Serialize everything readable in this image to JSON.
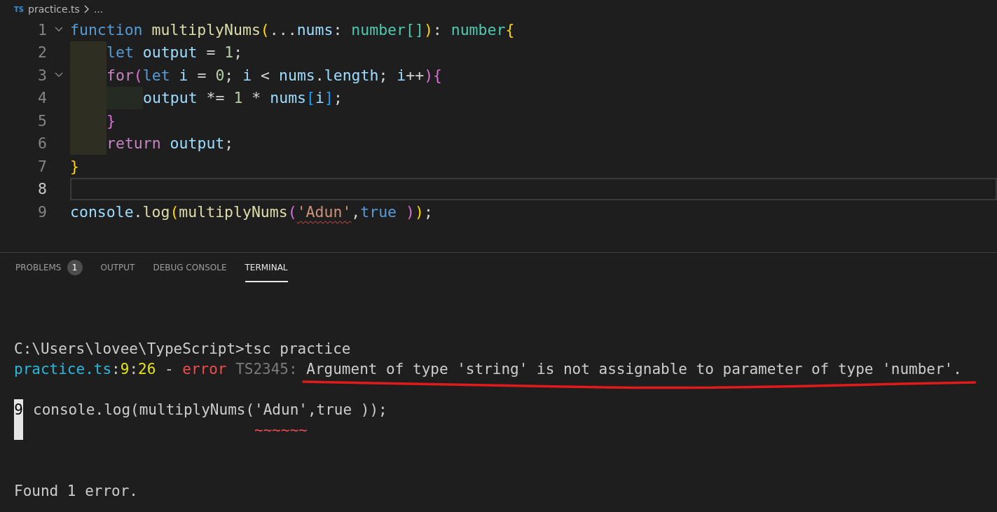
{
  "breadcrumbs": {
    "file_badge": "TS",
    "file": "practice.ts",
    "trail": "..."
  },
  "editor": {
    "lines": [
      {
        "number": "1",
        "current": false,
        "expanded": true,
        "tokens": [
          {
            "kind": "keyword",
            "text": "function "
          },
          {
            "kind": "func",
            "text": "multiplyNums"
          },
          {
            "kind": "bracket1",
            "text": "("
          },
          {
            "kind": "plain",
            "text": "..."
          },
          {
            "kind": "var",
            "text": "nums"
          },
          {
            "kind": "plain",
            "text": ": "
          },
          {
            "kind": "type",
            "text": "number[]"
          },
          {
            "kind": "bracket1",
            "text": ")"
          },
          {
            "kind": "plain",
            "text": ": "
          },
          {
            "kind": "type",
            "text": "number"
          },
          {
            "kind": "bracket1",
            "text": "{"
          }
        ],
        "children": [
          {
            "number": "2",
            "current": false,
            "tokens": [
              {
                "kind": "keyword",
                "text": "let "
              },
              {
                "kind": "var",
                "text": "output"
              },
              {
                "kind": "plain",
                "text": " = "
              },
              {
                "kind": "num",
                "text": "1"
              },
              {
                "kind": "plain",
                "text": ";"
              }
            ]
          },
          {
            "number": "3",
            "current": false,
            "expanded": true,
            "tokens": [
              {
                "kind": "control",
                "text": "for"
              },
              {
                "kind": "bracket2",
                "text": "("
              },
              {
                "kind": "keyword",
                "text": "let "
              },
              {
                "kind": "var",
                "text": "i"
              },
              {
                "kind": "plain",
                "text": " = "
              },
              {
                "kind": "num",
                "text": "0"
              },
              {
                "kind": "plain",
                "text": "; "
              },
              {
                "kind": "var",
                "text": "i"
              },
              {
                "kind": "plain",
                "text": " < "
              },
              {
                "kind": "var",
                "text": "nums"
              },
              {
                "kind": "plain",
                "text": "."
              },
              {
                "kind": "var",
                "text": "length"
              },
              {
                "kind": "plain",
                "text": "; "
              },
              {
                "kind": "var",
                "text": "i"
              },
              {
                "kind": "plain",
                "text": "++"
              },
              {
                "kind": "bracket2",
                "text": ")"
              },
              {
                "kind": "bracket2",
                "text": "{"
              }
            ],
            "children": [
              {
                "number": "4",
                "current": false,
                "tokens": [
                  {
                    "kind": "var",
                    "text": "output"
                  },
                  {
                    "kind": "plain",
                    "text": " *= "
                  },
                  {
                    "kind": "num",
                    "text": "1"
                  },
                  {
                    "kind": "plain",
                    "text": " * "
                  },
                  {
                    "kind": "var",
                    "text": "nums"
                  },
                  {
                    "kind": "bracket3",
                    "text": "["
                  },
                  {
                    "kind": "var",
                    "text": "i"
                  },
                  {
                    "kind": "bracket3",
                    "text": "]"
                  },
                  {
                    "kind": "plain",
                    "text": ";"
                  }
                ]
              }
            ]
          },
          {
            "number": "5",
            "current": false,
            "tokens": [
              {
                "kind": "bracket2",
                "text": "}"
              }
            ]
          },
          {
            "number": "6",
            "current": false,
            "tokens": [
              {
                "kind": "control",
                "text": "return "
              },
              {
                "kind": "var",
                "text": "output"
              },
              {
                "kind": "plain",
                "text": ";"
              }
            ]
          }
        ]
      },
      {
        "number": "7",
        "current": false,
        "tokens": [
          {
            "kind": "bracket1",
            "text": "}"
          }
        ]
      },
      {
        "number": "8",
        "current": true
      },
      {
        "number": "9",
        "current": false,
        "tokens": [
          {
            "kind": "var",
            "text": "console"
          },
          {
            "kind": "plain",
            "text": "."
          },
          {
            "kind": "func",
            "text": "log"
          },
          {
            "kind": "bracket1",
            "text": "("
          },
          {
            "kind": "func",
            "text": "multiplyNums"
          },
          {
            "kind": "bracket2",
            "text": "("
          },
          {
            "kind": "string",
            "text": "'Adun'",
            "error": true
          },
          {
            "kind": "plain",
            "text": ","
          },
          {
            "kind": "keyword",
            "text": "true "
          },
          {
            "kind": "bracket2",
            "text": ")"
          },
          {
            "kind": "bracket1",
            "text": ")"
          },
          {
            "kind": "plain",
            "text": ";"
          }
        ]
      }
    ]
  },
  "panel": {
    "tabs": [
      {
        "label": "PROBLEMS",
        "badge": "1",
        "selected": false
      },
      {
        "label": "OUTPUT",
        "selected": false
      },
      {
        "label": "DEBUG CONSOLE",
        "selected": false
      },
      {
        "label": "TERMINAL",
        "selected": true
      }
    ]
  },
  "terminal": {
    "command": "C:\\Users\\lovee\\TypeScript>tsc practice",
    "diagnostic": [
      {
        "kind": "file",
        "text": "practice.ts"
      },
      {
        "kind": "plain",
        "text": ":"
      },
      {
        "kind": "position",
        "text": "9"
      },
      {
        "kind": "plain",
        "text": ":"
      },
      {
        "kind": "position",
        "text": "26"
      },
      {
        "kind": "plain",
        "text": " - "
      },
      {
        "kind": "error",
        "text": "error"
      },
      {
        "kind": "code",
        "text": " TS2345: "
      },
      {
        "kind": "message",
        "text": "Argument of type 'string' is not assignable to parameter of type 'number'."
      }
    ],
    "source": {
      "line_number": "9",
      "code": "console.log(multiplyNums('Adun',true ));",
      "marker": "                         ~~~~~~"
    },
    "summary": "Found 1 error."
  }
}
